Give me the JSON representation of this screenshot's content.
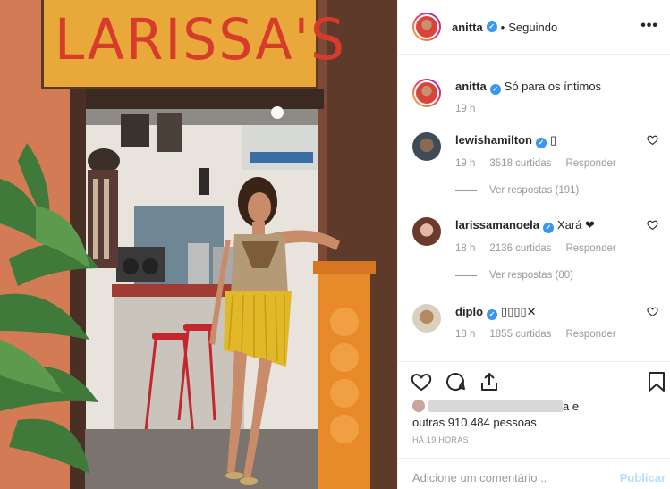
{
  "photo": {
    "sign_text": "LARISSA'S"
  },
  "header": {
    "username": "anitta",
    "verified_icon": "verified-badge-icon",
    "separator": "•",
    "follow_status": "Seguindo",
    "more_icon": "more-options-icon"
  },
  "caption": {
    "username": "anitta",
    "text": "Só para os íntimos",
    "time": "19 h"
  },
  "comments": [
    {
      "username": "lewishamilton",
      "text": "▯",
      "time": "19 h",
      "likes": "3518 curtidas",
      "reply": "Responder",
      "view_replies": "Ver respostas (191)"
    },
    {
      "username": "larissamanoela",
      "text": "Xará ❤",
      "time": "18 h",
      "likes": "2136 curtidas",
      "reply": "Responder",
      "view_replies": "Ver respostas (80)"
    },
    {
      "username": "diplo",
      "text": "▯▯▯▯✕",
      "time": "18 h",
      "likes": "1855 curtidas",
      "reply": "Responder"
    }
  ],
  "likes": {
    "suffix": "a e",
    "others": "outras 910.484 pessoas"
  },
  "posted_time": "HÁ 19 HORAS",
  "comment_box": {
    "placeholder": "Adicione um comentário...",
    "publish_label": "Publicar"
  },
  "colors": {
    "verified": "#3897f0",
    "publish_disabled": "#b2dffc",
    "sign_bg": "#e9a93a",
    "sign_text": "#d63b2b"
  }
}
